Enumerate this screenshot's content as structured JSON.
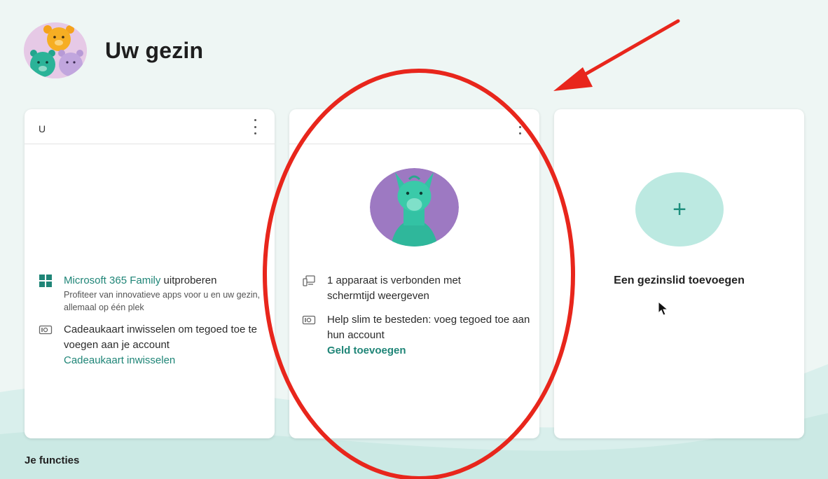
{
  "header": {
    "title": "Uw gezin",
    "avatar_icon": "bears-family-icon"
  },
  "cards": {
    "self": {
      "name": "U",
      "menu_icon": "more-vertical-icon",
      "ms365": {
        "icon": "microsoft-logo-icon",
        "link": "Microsoft 365 Family",
        "text": " uitproberen",
        "sub": "Profiteer van innovatieve apps voor u en uw gezin, allemaal op één plek"
      },
      "giftcard": {
        "icon": "gift-card-icon",
        "text": "Cadeaukaart inwisselen om tegoed toe te voegen aan je account",
        "link": "Cadeaukaart inwisselen"
      }
    },
    "member": {
      "menu_icon": "more-vertical-icon",
      "avatar_icon": "llama-avatar-icon",
      "device": {
        "icon": "devices-icon",
        "text": "1 apparaat is verbonden met schermtijd weergeven"
      },
      "money": {
        "icon": "gift-card-icon",
        "text": "Help slim te besteden: voeg tegoed toe aan hun account",
        "link": "Geld toevoegen"
      }
    },
    "add": {
      "plus": "+",
      "label": "Een gezinslid toevoegen"
    }
  },
  "footer": {
    "title": "Je functies"
  },
  "colors": {
    "accent": "#1f8577",
    "annotation": "#e8261c",
    "add_circle": "#bce9e1",
    "background": "#eef6f4"
  }
}
